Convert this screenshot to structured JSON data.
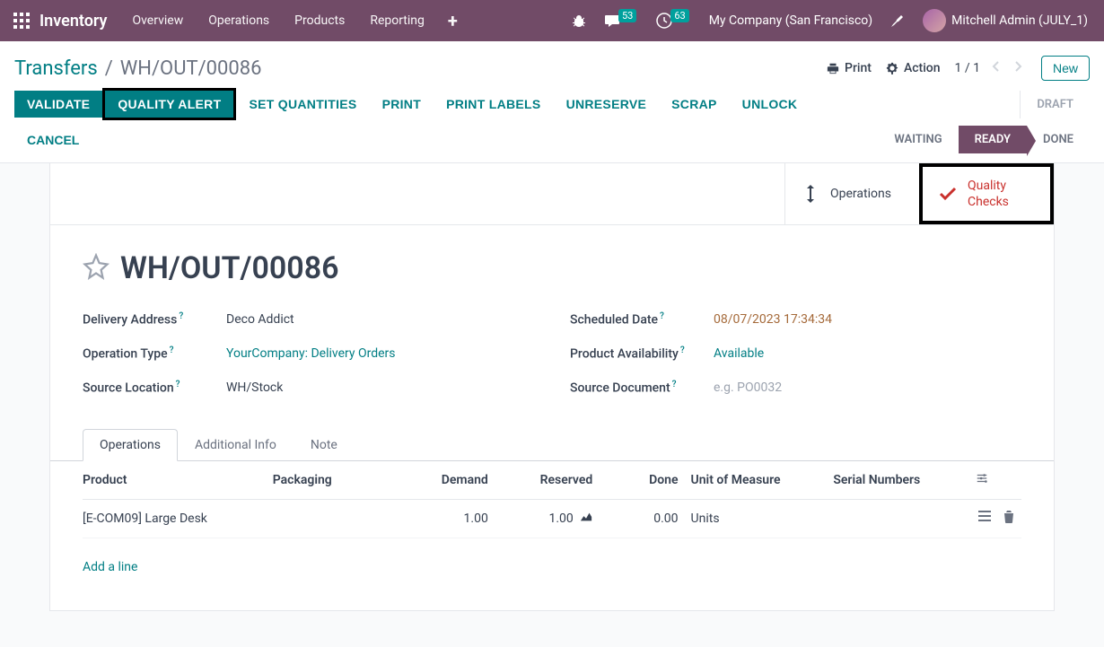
{
  "navbar": {
    "brand": "Inventory",
    "menu": [
      "Overview",
      "Operations",
      "Products",
      "Reporting"
    ],
    "messages_badge": "53",
    "activities_badge": "63",
    "company": "My Company (San Francisco)",
    "user": "Mitchell Admin (JULY_1)"
  },
  "breadcrumb": {
    "parent": "Transfers",
    "current": "WH/OUT/00086"
  },
  "cp": {
    "print": "Print",
    "action": "Action",
    "pager": "1 / 1",
    "new": "New"
  },
  "buttons": {
    "validate": "Validate",
    "quality_alert": "Quality Alert",
    "set_quantities": "Set Quantities",
    "print": "Print",
    "print_labels": "Print Labels",
    "unreserve": "Unreserve",
    "scrap": "Scrap",
    "unlock": "Unlock",
    "cancel": "Cancel"
  },
  "statusbar": {
    "draft": "Draft",
    "waiting": "Waiting",
    "ready": "Ready",
    "done": "Done"
  },
  "stat_buttons": {
    "operations": "Operations",
    "quality_checks_l1": "Quality",
    "quality_checks_l2": "Checks"
  },
  "record": {
    "title": "WH/OUT/00086",
    "fields": {
      "delivery_address": {
        "label": "Delivery Address",
        "value": "Deco Addict"
      },
      "operation_type": {
        "label": "Operation Type",
        "value": "YourCompany: Delivery Orders"
      },
      "source_location": {
        "label": "Source Location",
        "value": "WH/Stock"
      },
      "scheduled_date": {
        "label": "Scheduled Date",
        "value": "08/07/2023 17:34:34"
      },
      "product_availability": {
        "label": "Product Availability",
        "value": "Available"
      },
      "source_document": {
        "label": "Source Document",
        "placeholder": "e.g. PO0032"
      }
    }
  },
  "tabs": {
    "operations": "Operations",
    "additional_info": "Additional Info",
    "note": "Note"
  },
  "table": {
    "headers": {
      "product": "Product",
      "packaging": "Packaging",
      "demand": "Demand",
      "reserved": "Reserved",
      "done": "Done",
      "uom": "Unit of Measure",
      "serial": "Serial Numbers"
    },
    "rows": [
      {
        "product": "[E-COM09] Large Desk",
        "packaging": "",
        "demand": "1.00",
        "reserved": "1.00",
        "done": "0.00",
        "uom": "Units"
      }
    ],
    "add_line": "Add a line"
  }
}
